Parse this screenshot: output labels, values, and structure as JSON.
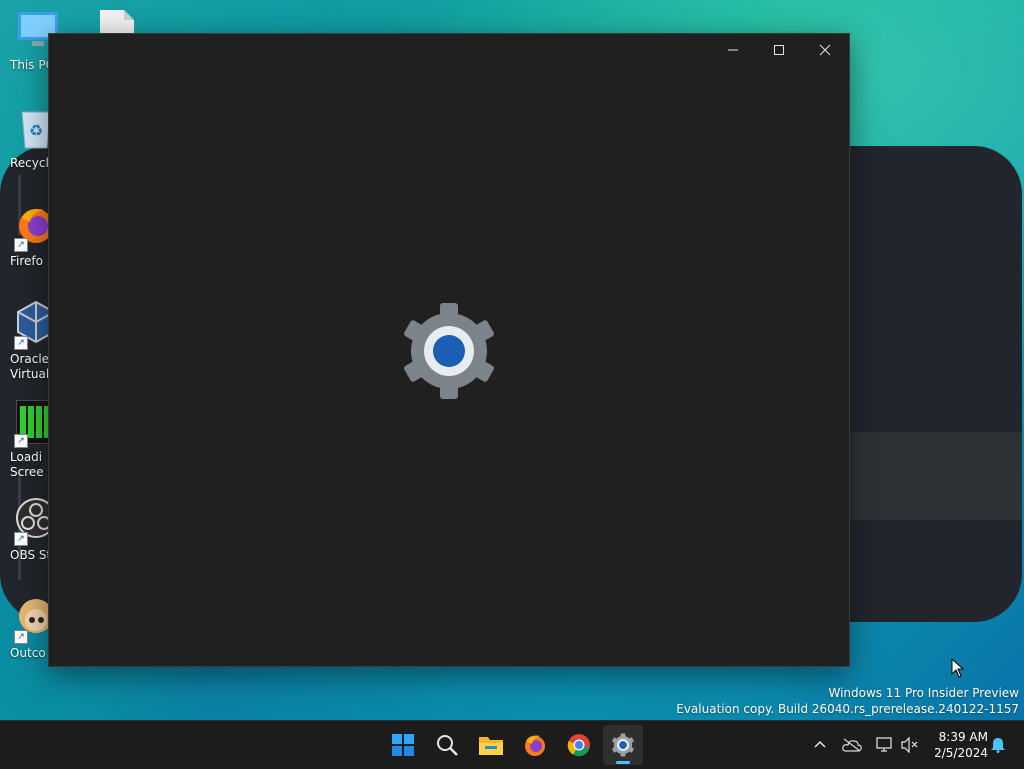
{
  "desktop": {
    "icons": [
      {
        "label": "This PC",
        "icon": "computer-icon"
      },
      {
        "label": "Recycle",
        "icon": "recycle-bin-icon"
      },
      {
        "label": "Firefo",
        "icon": "firefox-icon"
      },
      {
        "label": "Oracle",
        "label2": "Virtuall",
        "icon": "virtualbox-icon"
      },
      {
        "label": "Loadi",
        "label2": "Scree",
        "icon": "loading-screen-icon"
      },
      {
        "label": "OBS St",
        "icon": "obs-icon"
      },
      {
        "label": "Outco",
        "icon": "character-icon"
      }
    ],
    "file_icon": "file-icon"
  },
  "window": {
    "buttons": [
      "minimize-icon",
      "maximize-icon",
      "close-icon"
    ],
    "splash_icon": "settings-gear-icon",
    "colors": {
      "background": "#202020",
      "gear": "#7a7f86",
      "gear_center": "#1a5fb4"
    }
  },
  "watermark": {
    "line1": "Windows 11 Pro Insider Preview",
    "line2": "Evaluation copy. Build 26040.rs_prerelease.240122-1157"
  },
  "taskbar": {
    "apps": [
      "start-icon",
      "search-icon",
      "file-explorer-icon",
      "firefox-icon",
      "chrome-icon",
      "settings-icon"
    ],
    "active_app": "settings-icon",
    "tray": [
      "chevron-up-icon",
      "onedrive-icon",
      "network-icon",
      "volume-muted-icon"
    ],
    "time": "8:39 AM",
    "date": "2/5/2024",
    "notification_icon": "bell-icon",
    "accent": "#4cc2ff"
  }
}
